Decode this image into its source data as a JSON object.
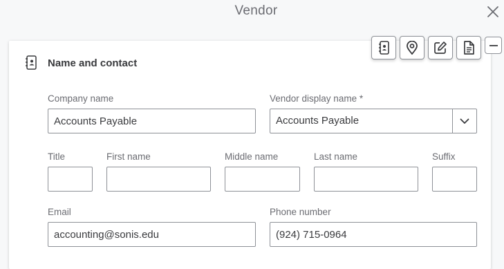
{
  "dialog": {
    "title": "Vendor"
  },
  "icons": {
    "close": "close-icon",
    "section": "contact-book-icon",
    "toolbar": [
      "contact-book-icon",
      "location-pin-icon",
      "edit-note-icon",
      "document-icon",
      "minimize-icon"
    ]
  },
  "section": {
    "title": "Name and contact"
  },
  "form": {
    "company_name": {
      "label": "Company name",
      "value": "Accounts Payable"
    },
    "display_name": {
      "label": "Vendor display name *",
      "value": "Accounts Payable"
    },
    "title": {
      "label": "Title",
      "value": ""
    },
    "first_name": {
      "label": "First name",
      "value": ""
    },
    "middle_name": {
      "label": "Middle name",
      "value": ""
    },
    "last_name": {
      "label": "Last name",
      "value": ""
    },
    "suffix": {
      "label": "Suffix",
      "value": ""
    },
    "email": {
      "label": "Email",
      "value": "accounting@sonis.edu"
    },
    "phone": {
      "label": "Phone number",
      "value": "(924) 715-0964"
    }
  },
  "colors": {
    "text": "#393a3d",
    "muted": "#6b6c72",
    "border": "#8d9096"
  }
}
